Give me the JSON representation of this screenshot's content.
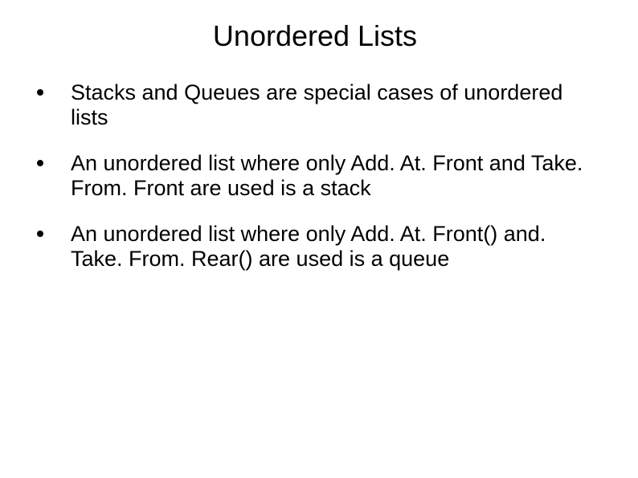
{
  "title": "Unordered Lists",
  "bullets": [
    "Stacks and Queues are special cases of unordered lists",
    "An unordered list where only Add. At. Front and Take. From. Front are used is a stack",
    "An unordered list where only Add. At. Front() and. Take. From. Rear() are used is a queue"
  ]
}
